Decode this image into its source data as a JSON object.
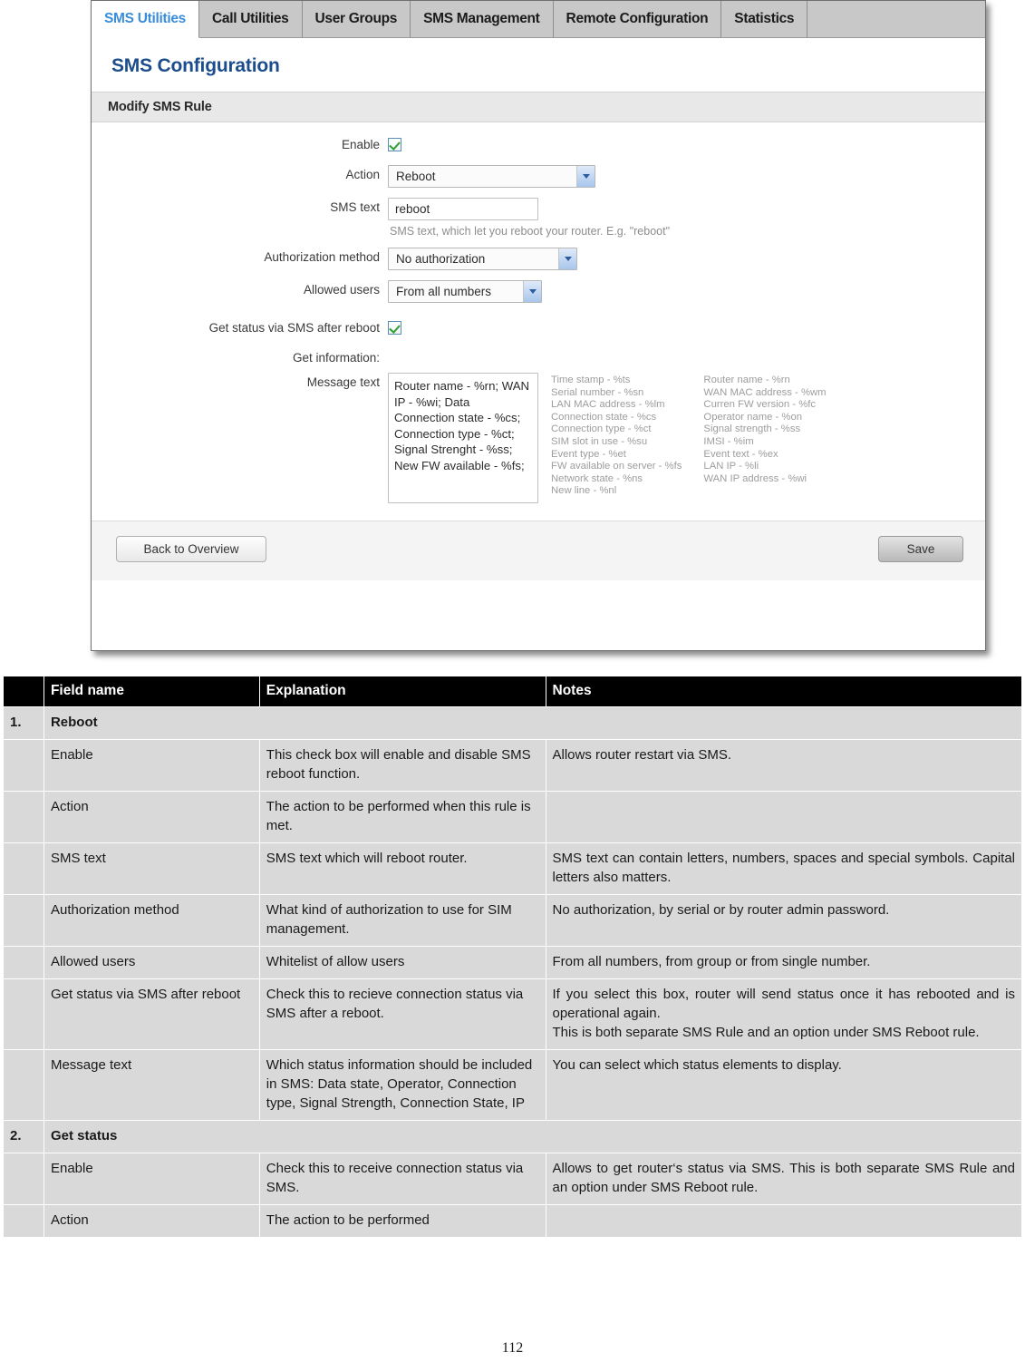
{
  "router_ui": {
    "tabs": [
      {
        "label": "SMS Utilities",
        "active": true
      },
      {
        "label": "Call Utilities",
        "active": false
      },
      {
        "label": "User Groups",
        "active": false
      },
      {
        "label": "SMS Management",
        "active": false
      },
      {
        "label": "Remote Configuration",
        "active": false
      },
      {
        "label": "Statistics",
        "active": false
      }
    ],
    "page_title": "SMS Configuration",
    "section_title": "Modify SMS Rule",
    "accent_color": "#1b4c8c",
    "active_tab_color": "#3a8ddb",
    "form": {
      "enable": {
        "label": "Enable",
        "checked": true
      },
      "action": {
        "label": "Action",
        "value": "Reboot"
      },
      "sms_text": {
        "label": "SMS text",
        "value": "reboot",
        "hint": "SMS text, which let you reboot your router. E.g. \"reboot\""
      },
      "authorization_method": {
        "label": "Authorization method",
        "value": "No authorization"
      },
      "allowed_users": {
        "label": "Allowed users",
        "value": "From all numbers"
      },
      "get_status_after_reboot": {
        "label": "Get status via SMS after reboot",
        "checked": true
      },
      "get_information_label": "Get information:",
      "message_text": {
        "label": "Message text",
        "value": "Router name - %rn; WAN IP - %wi; Data Connection state - %cs; Connection type - %ct; Signal Strenght - %ss; New FW available - %fs;"
      },
      "legend_col1": [
        "Time stamp - %ts",
        "Serial number - %sn",
        "LAN MAC address - %lm",
        "Connection state - %cs",
        "Connection type - %ct",
        "SIM slot in use - %su",
        "Event type - %et",
        "FW available on server - %fs",
        "Network state - %ns",
        "New line - %nl"
      ],
      "legend_col2": [
        "Router name - %rn",
        "WAN MAC address - %wm",
        "Curren FW version - %fc",
        "Operator name - %on",
        "Signal strength - %ss",
        "IMSI - %im",
        "Event text - %ex",
        "LAN IP - %li",
        "WAN IP address - %wi"
      ]
    },
    "buttons": {
      "back": "Back to Overview",
      "save": "Save"
    }
  },
  "doc_table": {
    "headers": [
      "",
      "Field name",
      "Explanation",
      "Notes"
    ],
    "rows": [
      {
        "type": "group",
        "num": "1.",
        "field": "Reboot"
      },
      {
        "type": "row",
        "num": "",
        "field": "Enable",
        "explanation": "This check box will enable and disable SMS reboot function.",
        "notes": "Allows router restart via SMS."
      },
      {
        "type": "row",
        "num": "",
        "field": "Action",
        "explanation": "The action to be performed when this rule is met.",
        "notes": ""
      },
      {
        "type": "row",
        "num": "",
        "field": "SMS text",
        "explanation": "SMS text which will reboot router.",
        "notes": "SMS text can contain letters, numbers, spaces and special symbols. Capital letters also matters."
      },
      {
        "type": "row",
        "num": "",
        "field": "Authorization method",
        "explanation": "What kind of authorization to use for SIM management.",
        "notes": "No authorization, by serial or by router admin password."
      },
      {
        "type": "row",
        "num": "",
        "field": "Allowed users",
        "explanation": "Whitelist of allow users",
        "notes": "From all numbers, from group or from single number."
      },
      {
        "type": "row",
        "num": "",
        "field": "Get status via SMS after reboot",
        "explanation": "Check this to recieve connection status via SMS after a reboot.",
        "notes": "If you select this box, router will send status once it has rebooted and is operational again.\nThis is both separate SMS Rule and an option under SMS Reboot rule."
      },
      {
        "type": "row",
        "num": "",
        "field": "Message text",
        "explanation": "Which status information should be included in SMS: Data state, Operator, Connection type, Signal Strength, Connection State, IP",
        "notes": "You can select which status elements to display."
      },
      {
        "type": "group",
        "num": "2.",
        "field": "Get status"
      },
      {
        "type": "row",
        "num": "",
        "field": "Enable",
        "explanation": "Check this to receive connection status via SMS.",
        "notes": "Allows to get router‘s status via SMS. This is both separate SMS Rule and an option under SMS Reboot rule."
      },
      {
        "type": "row",
        "num": "",
        "field": "Action",
        "explanation": "The action to be performed",
        "notes": ""
      }
    ]
  },
  "page_number": "112"
}
